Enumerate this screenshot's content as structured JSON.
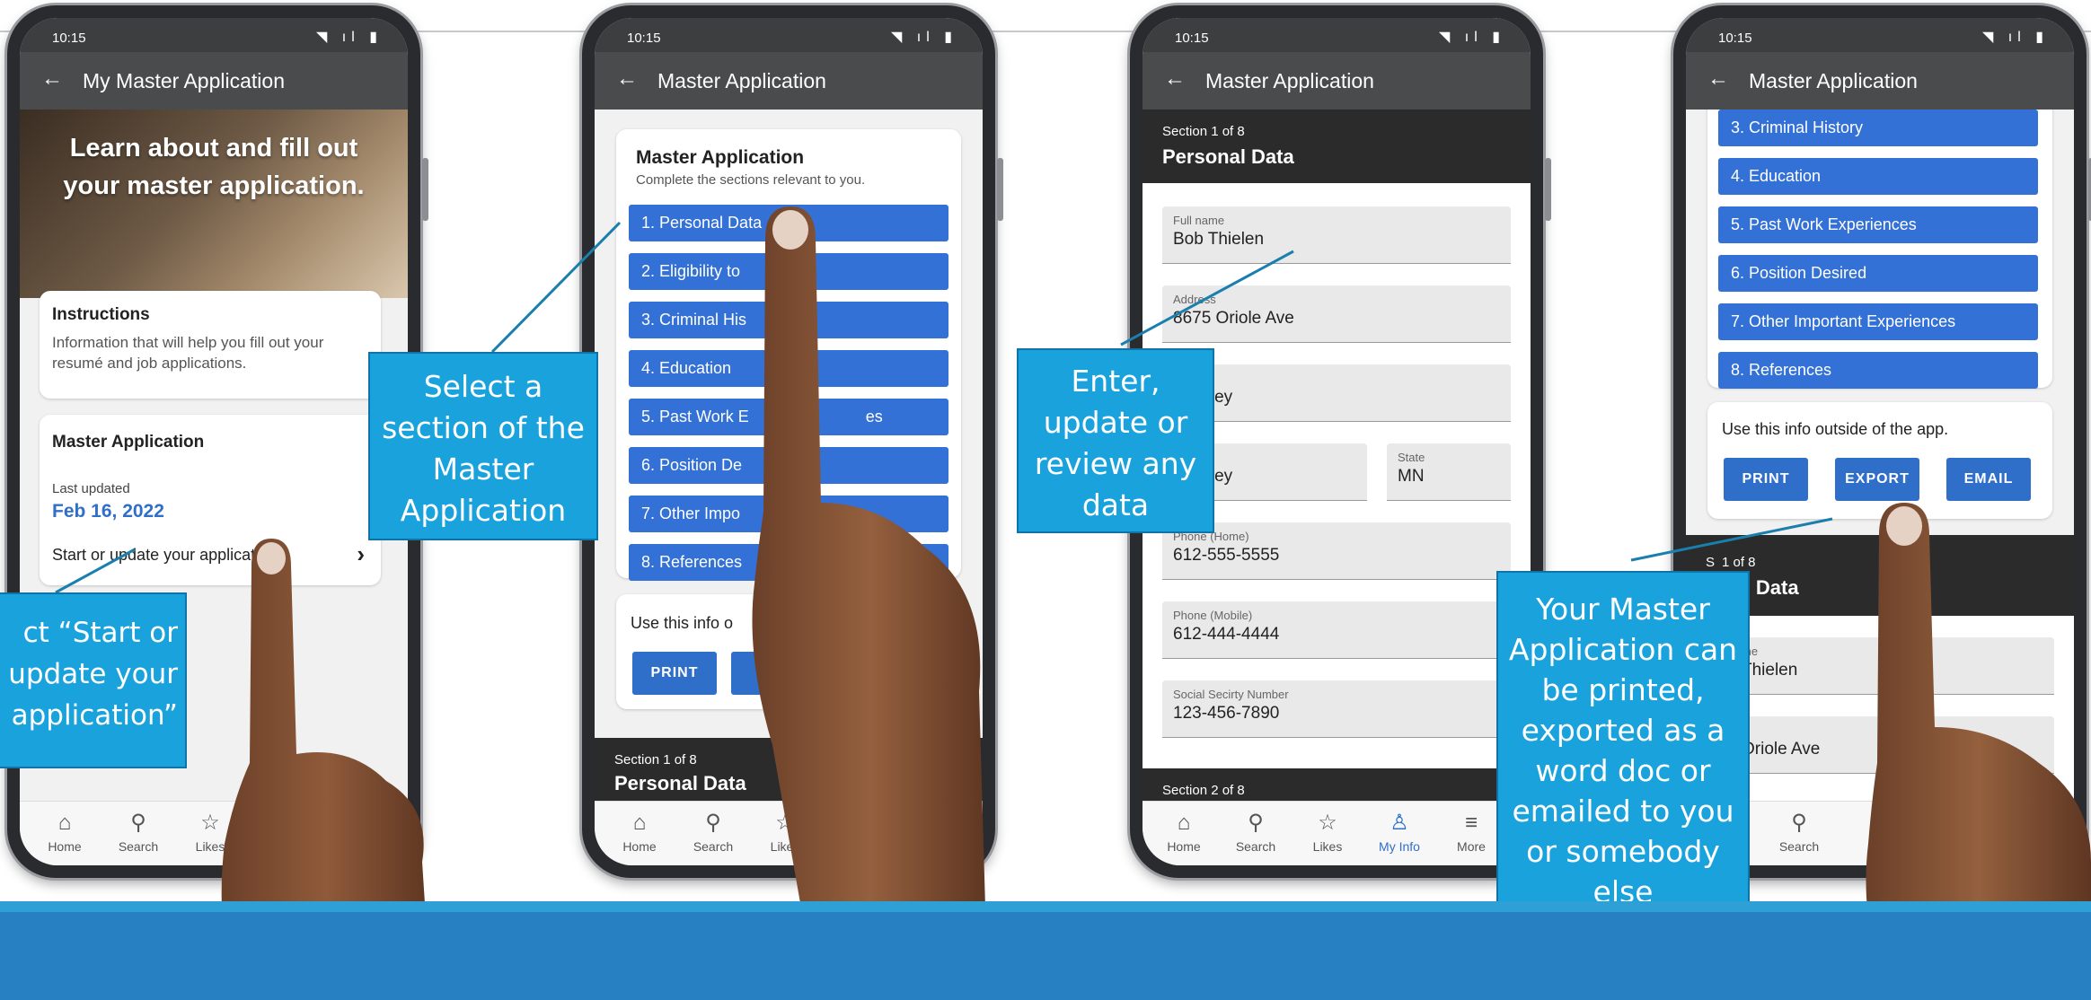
{
  "status_time": "10:15",
  "nav": {
    "home": "Home",
    "search": "Search",
    "likes": "Likes",
    "myinfo": "My Info",
    "more": "More"
  },
  "phone1": {
    "title": "My Master Application",
    "hero_text": "Learn about and fill out your master application.",
    "instructions_title": "Instructions",
    "instructions_text": "Information that will help you fill out your resumé and job applications.",
    "master_title": "Master Application",
    "last_updated_label": "Last updated",
    "last_updated_date": "Feb 16, 2022",
    "start_link": "Start or update your application"
  },
  "phone2": {
    "title": "Master Application",
    "card_title": "Master Application",
    "card_subtitle": "Complete the sections relevant to you.",
    "sections": [
      "1. Personal Data",
      "2. Eligibility to",
      "3. Criminal His",
      "4. Education",
      "5. Past Work E",
      "6. Position De",
      "7. Other Impo",
      "8. References"
    ],
    "sections_tail": [
      "",
      "",
      "",
      "",
      "es",
      "",
      "",
      ""
    ],
    "use_info": "Use this info o",
    "print": "PRINT",
    "section_count": "Section 1 of 8",
    "section_name": "Personal Data"
  },
  "phone3": {
    "title": "Master Application",
    "section_count": "Section 1 of 8",
    "section_name": "Personal Data",
    "fields": {
      "full_name_label": "Full name",
      "full_name_value": "Bob Thielen",
      "address_label": "Address",
      "address_value": "8675 Oriole Ave",
      "city_value": "n Valley",
      "city2_value": "n Valley",
      "state_label": "State",
      "state_value": "MN",
      "phone_home_label": "Phone (Home)",
      "phone_home_value": "612-555-5555",
      "phone_mobile_label": "Phone (Mobile)",
      "phone_mobile_value": "612-444-4444",
      "ssn_label": "Social Secirty Number",
      "ssn_value": "123-456-7890"
    },
    "next_section": "Section 2 of 8"
  },
  "phone4": {
    "title": "Master Application",
    "sections": [
      "3. Criminal History",
      "4. Education",
      "5. Past Work Experiences",
      "6. Position Desired",
      "7. Other Important Experiences",
      "8. References"
    ],
    "use_info": "Use this info outside of the app.",
    "print": "PRINT",
    "export": "EXPORT",
    "email": "EMAIL",
    "section_count_tail": "1 of 8",
    "section_count_head": "S",
    "section_name": "nal Data",
    "name_label_tail": "me",
    "name_value": "Thielen",
    "address_label_tail": "s",
    "address_value": "Oriole Ave"
  },
  "callouts": {
    "c1": "ct “Start or update your application”",
    "c2": "Select a section of the Master Application",
    "c3": "Enter, update or review any data",
    "c4": "Your Master Application can be printed, exported as a word doc or emailed to you or somebody else"
  },
  "colors": {
    "accent": "#3371d6",
    "callout": "#1aa2dd",
    "band": "#2680c2",
    "appbar": "#4a4b4d"
  }
}
